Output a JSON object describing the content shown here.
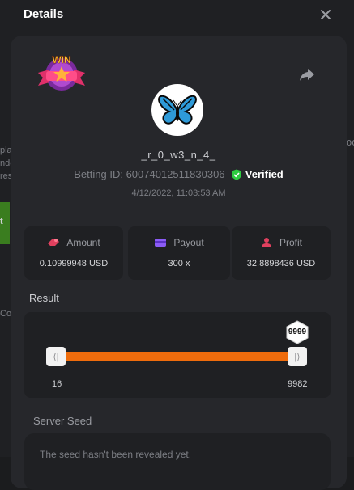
{
  "modal": {
    "title": "Details"
  },
  "background": {
    "text_fragments": [
      "pla",
      "ndo",
      "res",
      "t",
      "Co",
      "oo"
    ]
  },
  "bet": {
    "badge": "WIN",
    "username": "_r_0_w3_n_4_",
    "betting_id_label": "Betting ID:",
    "betting_id": "60074012511830306",
    "verified_label": "Verified",
    "timestamp": "4/12/2022, 11:03:53 AM",
    "avatar_icon": "butterfly-icon"
  },
  "stats": [
    {
      "label": "Amount",
      "value": "0.10999948 USD",
      "icon": "amount-icon",
      "color": "#e0405e"
    },
    {
      "label": "Payout",
      "value": "300 x",
      "icon": "payout-card-icon",
      "color": "#8b5cf6"
    },
    {
      "label": "Profit",
      "value": "32.8898436 USD",
      "icon": "profit-icon",
      "color": "#e0405e"
    }
  ],
  "result": {
    "label": "Result",
    "value_badge": "9999",
    "min_label": "16",
    "max_label": "9982",
    "track_color": "#ef6c0c"
  },
  "server_seed": {
    "label": "Server Seed",
    "text": "The seed hasn't been revealed yet."
  },
  "colors": {
    "accent": "#ef6c0c",
    "verified": "#2ecc40"
  }
}
